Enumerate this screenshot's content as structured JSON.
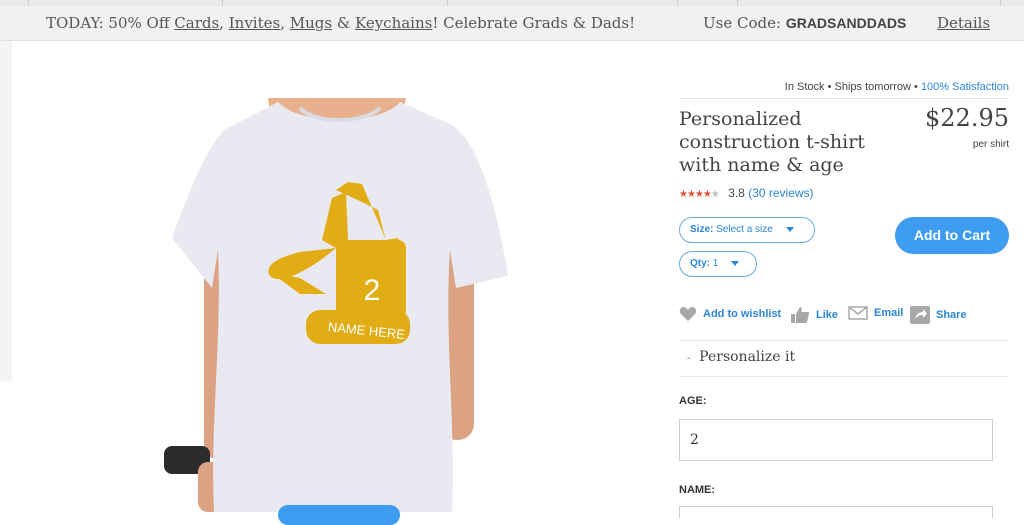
{
  "promo": {
    "today": "TODAY: 50% Off",
    "links": [
      "Cards",
      "Invites",
      "Mugs",
      "Keychains"
    ],
    "sep1": ",",
    "sep2": ",",
    "amp": "&",
    "tail": "! Celebrate Grads & Dads!",
    "code_label": "Use Code:",
    "code": "GRADSANDDADS",
    "details": "Details"
  },
  "status": {
    "stock": "In Stock",
    "ships": "Ships tomorrow",
    "satisfaction": "100% Satisfaction",
    "dot": "•"
  },
  "product": {
    "title": "Personalized construction t-shirt with name & age",
    "price": "$22.95",
    "price_unit": "per shirt",
    "rating": 3.8,
    "rating_text": "3.8",
    "reviews": "(30 reviews)",
    "shirt_number": "2",
    "shirt_name": "NAME HERE",
    "shirt_color": "#e9eaf1",
    "print_color": "#e2ad14"
  },
  "options": {
    "size_label": "Size:",
    "size_value": "Select a size",
    "qty_label": "Qty:",
    "qty_value": "1"
  },
  "cart": {
    "add_label": "Add to Cart"
  },
  "actions": {
    "wishlist": "Add to wishlist",
    "like": "Like",
    "email": "Email",
    "share": "Share"
  },
  "personalize": {
    "header": "Personalize it",
    "bullet": "-",
    "age_label": "AGE:",
    "age_value": "2",
    "name_label": "NAME:"
  },
  "colors": {
    "accent": "#3d9bf0",
    "link": "#2a86d6",
    "star": "#e0503a"
  }
}
